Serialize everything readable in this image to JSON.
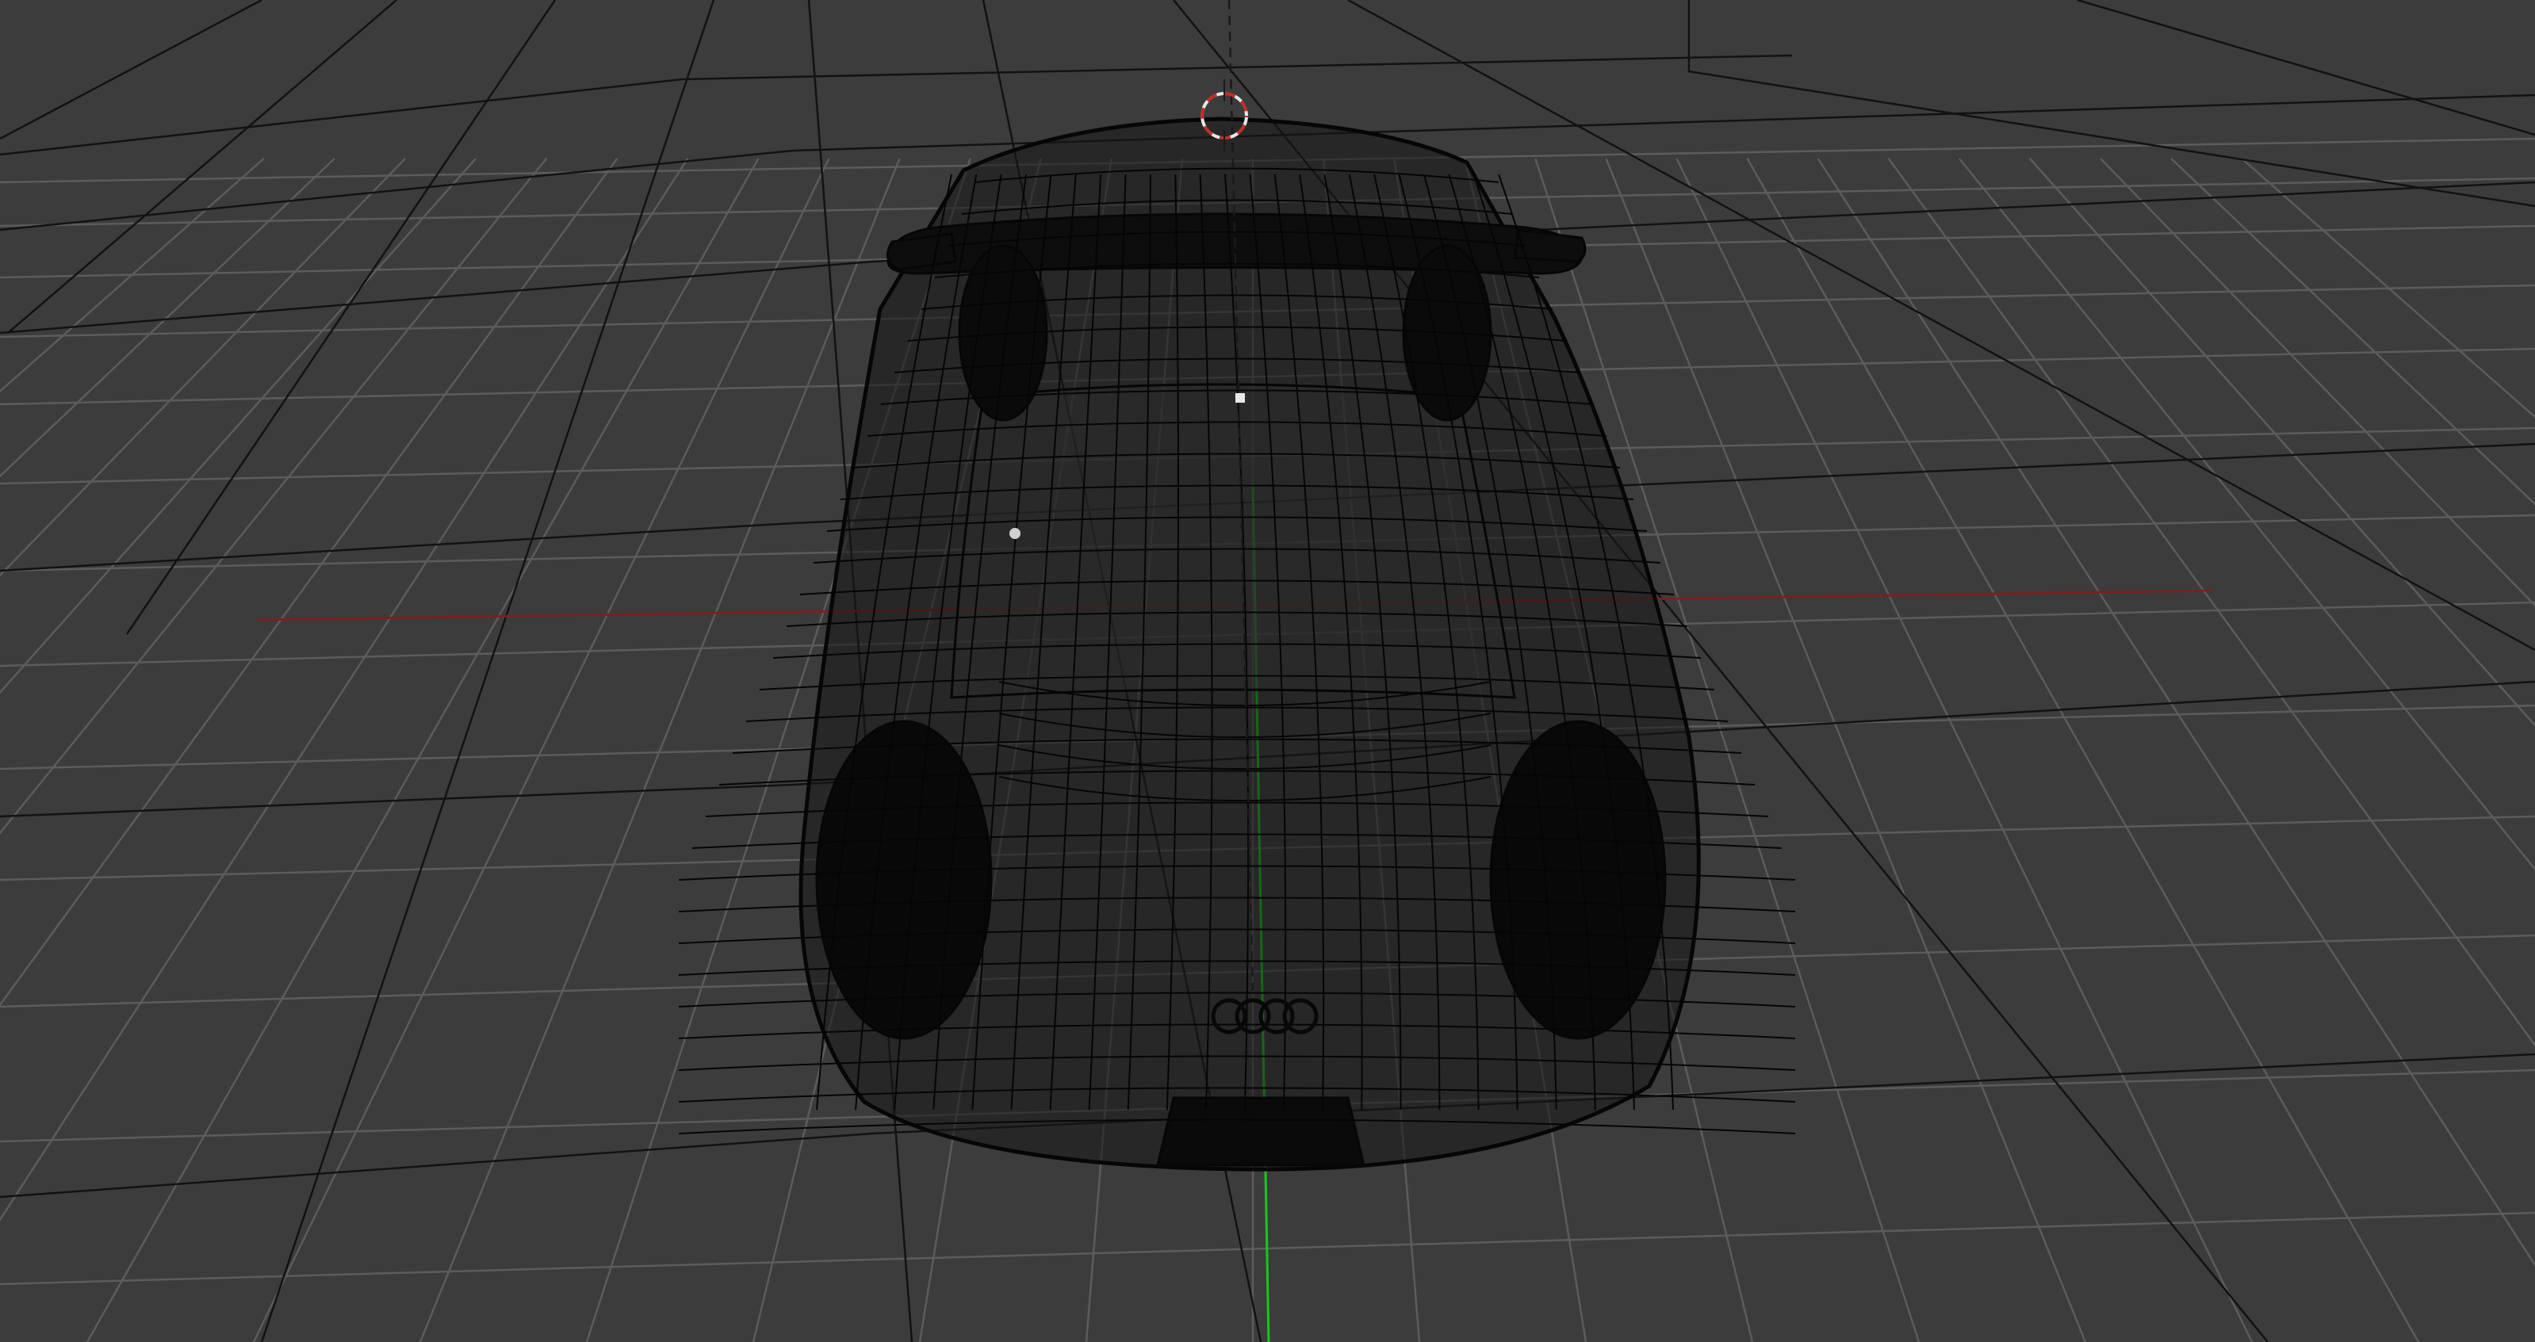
{
  "viewport": {
    "view": "perspective",
    "shading": "wireframe",
    "background_color": "#3c3c3c"
  },
  "colors": {
    "grid_minor": "#5c5c5c",
    "grid_major": "#111111",
    "x_axis": "#7a2020",
    "y_axis": "#17c917",
    "wireframe": "#060606",
    "pivot_dash": "#1a1a1a",
    "cursor_red": "#c0302a",
    "cursor_white": "#e8e8e8"
  },
  "icons": {
    "cursor": "3d-cursor-icon",
    "object_origin": "object-origin-icon"
  },
  "scene": {
    "object": "car-wireframe",
    "emblem": "four-ring-emblem"
  }
}
